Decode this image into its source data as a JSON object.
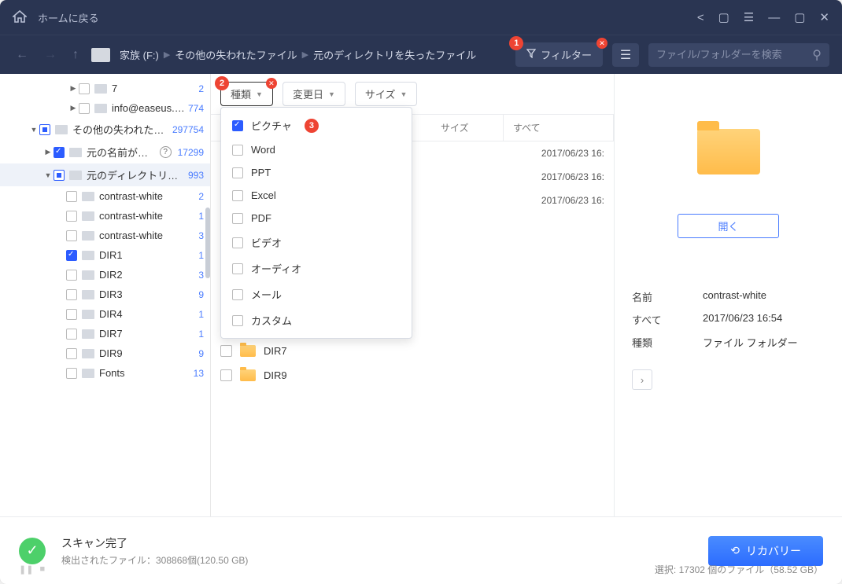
{
  "titlebar": {
    "home_link": "ホームに戻る"
  },
  "breadcrumb": {
    "drive": "家族 (F:)",
    "path1": "その他の失われたファイル",
    "path2": "元のディレクトリを失ったファイル"
  },
  "filter_button": "フィルター",
  "search": {
    "placeholder": "ファイル/フォルダーを検索"
  },
  "filters": {
    "type": "種類",
    "date": "変更日",
    "size": "サイズ"
  },
  "badges": {
    "filter": "1",
    "type": "2",
    "picture": "3"
  },
  "dropdown": [
    {
      "label": "ピクチャ",
      "checked": true
    },
    {
      "label": "Word",
      "checked": false
    },
    {
      "label": "PPT",
      "checked": false
    },
    {
      "label": "Excel",
      "checked": false
    },
    {
      "label": "PDF",
      "checked": false
    },
    {
      "label": "ビデオ",
      "checked": false
    },
    {
      "label": "オーディオ",
      "checked": false
    },
    {
      "label": "メール",
      "checked": false
    },
    {
      "label": "カスタム",
      "checked": false
    }
  ],
  "tree": {
    "r0": {
      "label": "7",
      "count": "2"
    },
    "r1": {
      "label": "info@easeus.…",
      "count": "774"
    },
    "r2": {
      "label": "その他の失われたフ…",
      "count": "297754"
    },
    "r3": {
      "label": "元の名前が失…",
      "count": "17299"
    },
    "r4": {
      "label": "元のディレクトリを失っ…",
      "count": "993"
    },
    "r5": {
      "label": "contrast-white",
      "count": "2"
    },
    "r6": {
      "label": "contrast-white",
      "count": "1"
    },
    "r7": {
      "label": "contrast-white",
      "count": "3"
    },
    "r8": {
      "label": "DIR1",
      "count": "1"
    },
    "r9": {
      "label": "DIR2",
      "count": "3"
    },
    "r10": {
      "label": "DIR3",
      "count": "9"
    },
    "r11": {
      "label": "DIR4",
      "count": "1"
    },
    "r12": {
      "label": "DIR7",
      "count": "1"
    },
    "r13": {
      "label": "DIR9",
      "count": "9"
    },
    "r14": {
      "label": "Fonts",
      "count": "13"
    }
  },
  "table_headers": {
    "size": "サイズ",
    "all": "すべて"
  },
  "rows_visible": {
    "d0": "2017/06/23 16:",
    "d1": "2017/06/23 16:",
    "d2": "2017/06/23 16:"
  },
  "files": {
    "f0": "DIR4",
    "f1": "DIR7",
    "f2": "DIR9"
  },
  "preview": {
    "open_btn": "開く",
    "name_label": "名前",
    "name_value": "contrast-white",
    "all_label": "すべて",
    "all_value": "2017/06/23 16:54",
    "type_label": "種類",
    "type_value": "ファイル フォルダー"
  },
  "footer": {
    "title": "スキャン完了",
    "subtitle": "検出されたファイル：308868個(120.50 GB)",
    "recover": "リカバリー",
    "selection": "選択: 17302 個のファイル（58.52 GB）"
  }
}
